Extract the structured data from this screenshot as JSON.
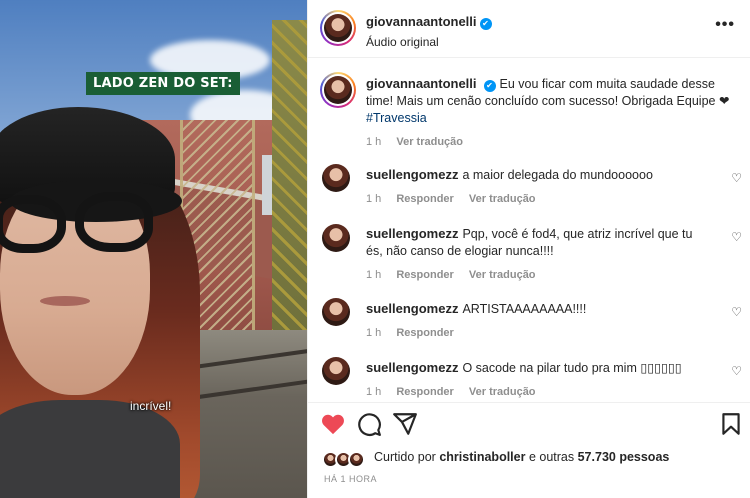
{
  "media": {
    "overlay_label": "LADO ZEN DO SET:",
    "caption": "incrível!"
  },
  "header": {
    "username": "giovannaantonelli",
    "verified_icon": "✔",
    "subtitle": "Áudio original",
    "more_icon": "•••"
  },
  "post": {
    "username": "giovannaantonelli",
    "verified_icon": "✔",
    "text": "Eu vou ficar com muita saudade desse time! Mais um cenão concluído com sucesso! Obrigada Equipe ❤",
    "hashtag": "#Travessia",
    "time": "1 h",
    "translate": "Ver tradução"
  },
  "comments": [
    {
      "username": "suellengomezz",
      "text": "a maior delegada do mundoooooo",
      "time": "1 h",
      "reply": "Responder",
      "translate": "Ver tradução",
      "has_like": true
    },
    {
      "username": "suellengomezz",
      "text": "Pqp, você é fod4, que atriz incrível que tu és, não canso de elogiar nunca!!!!",
      "time": "1 h",
      "reply": "Responder",
      "translate": "Ver tradução",
      "has_like": true
    },
    {
      "username": "suellengomezz",
      "text": "ARTISTAAAAAAAA!!!!",
      "time": "1 h",
      "reply": "Responder",
      "translate": "",
      "has_like": true
    },
    {
      "username": "suellengomezz",
      "text": "O sacode na pilar tudo pra mim ▯▯▯▯▯▯",
      "time": "1 h",
      "reply": "Responder",
      "translate": "Ver tradução",
      "has_like": true
    }
  ],
  "likes": {
    "prefix": "Curtido por",
    "user": "christinaboller",
    "suffix": "e outras",
    "count": "57.730 pessoas"
  },
  "timestamp": "HÁ 1 HORA",
  "icons": {
    "like": "heart-icon",
    "comment": "comment-icon",
    "share": "share-icon",
    "save": "bookmark-icon",
    "small_like": "heart-outline-icon"
  },
  "colors": {
    "like_red": "#ed4956",
    "overlay_green": "#1a5e35",
    "verified_blue": "#0095f6"
  }
}
